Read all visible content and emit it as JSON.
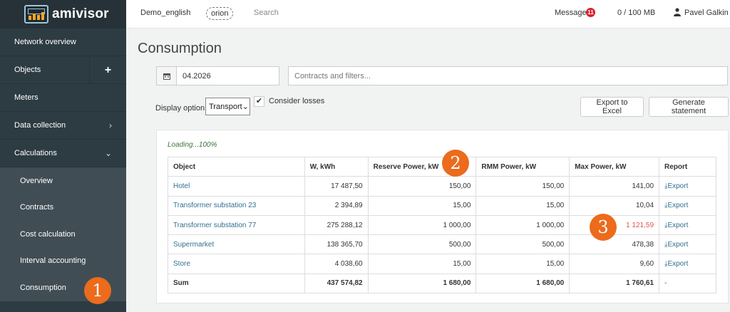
{
  "app": {
    "logo_text": "amivisor"
  },
  "sidebar": {
    "items": [
      {
        "label": "Network overview"
      },
      {
        "label": "Objects"
      },
      {
        "label": "Meters"
      },
      {
        "label": "Data collection"
      },
      {
        "label": "Calculations"
      }
    ],
    "sub_items": [
      {
        "label": "Overview"
      },
      {
        "label": "Contracts"
      },
      {
        "label": "Cost calculation"
      },
      {
        "label": "Interval accounting"
      },
      {
        "label": "Consumption"
      }
    ]
  },
  "topbar": {
    "project": "Demo_english",
    "tag": "orion",
    "search": "Search",
    "messages": "Messages",
    "messages_count": "11",
    "storage": "0 / 100 MB",
    "user": "Pavel Galkin"
  },
  "page": {
    "title": "Consumption"
  },
  "controls": {
    "date_value": "04.2026",
    "filters_placeholder": "Contracts and filters...",
    "display_label": "Display option:",
    "display_value": "Transport",
    "consider_losses": "Consider losses",
    "export_excel": "Export to Excel",
    "generate_statement": "Generate statement"
  },
  "report": {
    "loading": "Loading...100%",
    "headers": [
      "Object",
      "W, kWh",
      "Reserve Power, kW",
      "RMM Power, kW",
      "Max Power, kW",
      "Report"
    ],
    "rows": [
      {
        "object": "Hotel",
        "w": "17 487,50",
        "reserve": "150,00",
        "rmm": "150,00",
        "max": "141,00",
        "report": "Export"
      },
      {
        "object": "Transformer substation 23",
        "w": "2 394,89",
        "reserve": "15,00",
        "rmm": "15,00",
        "max": "10,04",
        "report": "Export"
      },
      {
        "object": "Transformer substation 77",
        "w": "275 288,12",
        "reserve": "1 000,00",
        "rmm": "1 000,00",
        "max": "1 121,59",
        "report": "Export"
      },
      {
        "object": "Supermarket",
        "w": "138 365,70",
        "reserve": "500,00",
        "rmm": "500,00",
        "max": "478,38",
        "report": "Export"
      },
      {
        "object": "Store",
        "w": "4 038,60",
        "reserve": "15,00",
        "rmm": "15,00",
        "max": "9,60",
        "report": "Export"
      }
    ],
    "sum": {
      "label": "Sum",
      "w": "437 574,82",
      "reserve": "1 680,00",
      "rmm": "1 680,00",
      "max": "1 760,61",
      "report": "-"
    }
  },
  "callouts": [
    "1",
    "2",
    "3"
  ],
  "colors": {
    "sidebar": "#2d3b43",
    "callout": "#ec6b1c",
    "link": "#31708f",
    "exceed": "#e0554e",
    "badge": "#d9232d"
  }
}
